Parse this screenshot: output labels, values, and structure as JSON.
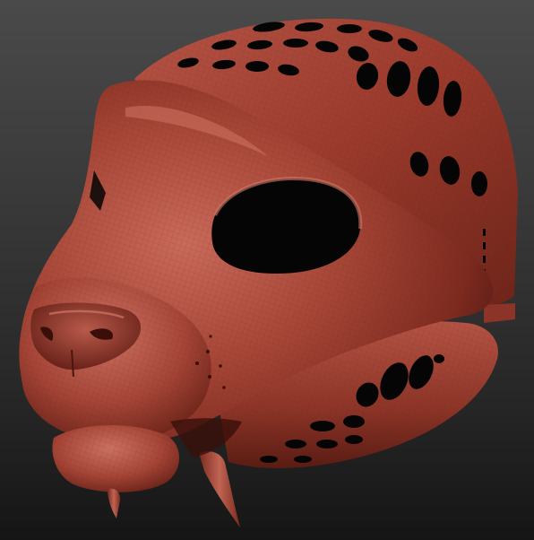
{
  "scene": {
    "subject": "sculpted-feline-mask-3d-model",
    "colors": {
      "background_top": "#4a4a4a",
      "background_bottom": "#151515",
      "clay_base": "#9a3a2c",
      "clay_highlight": "#c96a5a",
      "clay_shadow": "#4a1610",
      "hole": "#050505",
      "fang": "#a8483a"
    }
  }
}
